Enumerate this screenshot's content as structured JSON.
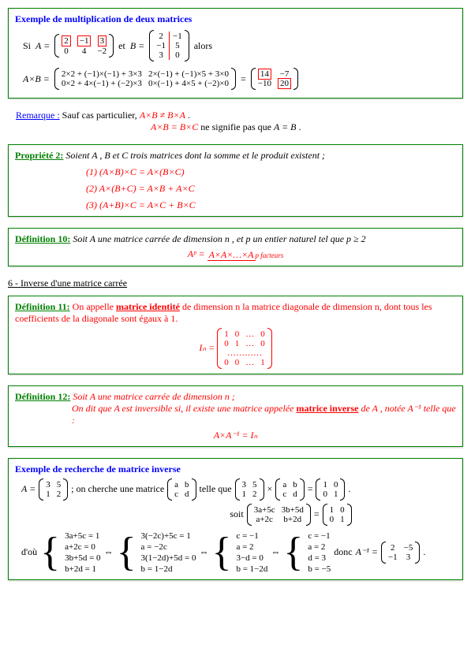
{
  "box1": {
    "title": "Exemple de multiplication de deux matrices",
    "si": "Si",
    "aeq": "A =",
    "et": "et",
    "beq": "B =",
    "A": [
      [
        "2",
        "−1",
        "3"
      ],
      [
        "0",
        "4",
        "−2"
      ]
    ],
    "B": [
      [
        "2",
        "−1"
      ],
      [
        "−1",
        "5"
      ],
      [
        "3",
        "0"
      ]
    ],
    "alors": "alors",
    "axb": "A×B =",
    "expand": [
      [
        "2×2 + (−1)×(−1) + 3×3",
        "2×(−1) + (−1)×5 + 3×0"
      ],
      [
        "0×2 + 4×(−1) + (−2)×3",
        "0×(−1) + 4×5 + (−2)×0"
      ]
    ],
    "eq": "=",
    "result": [
      [
        "14",
        "−7"
      ],
      [
        "−10",
        "20"
      ]
    ]
  },
  "remark": {
    "label": "Remarque :",
    "l1a": "Sauf cas particulier, ",
    "l1b": "A×B ≠ B×A",
    "dot1": ".",
    "l2": "A×B = B×C",
    "l2b": " ne signifie pas que ",
    "l2c": "A = B",
    "dot2": " ."
  },
  "box2": {
    "title": "Propriété 2:",
    "intro": " Soient A , B et C trois matrices dont la somme et le produit existent ;",
    "p1": "(1) (A×B)×C = A×(B×C)",
    "p2": "(2) A×(B+C) = A×B + A×C",
    "p3": "(3) (A+B)×C = A×C + B×C"
  },
  "box3": {
    "title": "Définition 10:",
    "intro": " Soit A une matrice carrée de dimension n , et p un entier naturel tel que p ≥ 2",
    "ap": "Aᵖ = ",
    "top": "A×A×…×A",
    "bot": "p facteurs"
  },
  "section6": "6 - Inverse d'une matrice carrée",
  "box4": {
    "title": "Définition 11:",
    "l1": " On appelle ",
    "u1": "matrice identité",
    "l2": " de dimension n la matrice diagonale de dimension n, dont tous les coefficients de la diagonale sont égaux à 1.",
    "in": "Iₙ =",
    "M": [
      [
        "1",
        "0",
        "…",
        "0"
      ],
      [
        "0",
        "1",
        "…",
        "0"
      ],
      [
        "",
        "…………",
        "",
        " "
      ],
      [
        "0",
        "0",
        "…",
        "1"
      ]
    ]
  },
  "box5": {
    "title": "Définition 12:",
    "l1": " Soit A une matrice carrée de dimension n ;",
    "l2a": "On dit que A est inversible si, il existe une matrice appelée ",
    "u2": "matrice inverse",
    "l2b": " de A , notée A⁻¹ telle que :",
    "eq": "A×A⁻¹ = Iₙ"
  },
  "box6": {
    "title": "Exemple de recherche de matrice inverse",
    "aeq": "A =",
    "A": [
      [
        "3",
        "5"
      ],
      [
        "1",
        "2"
      ]
    ],
    "txt1": "; on cherche une matrice",
    "ab": [
      [
        "a",
        "b"
      ],
      [
        "c",
        "d"
      ]
    ],
    "txt2": "telle que",
    "times": "×",
    "eq": "=",
    "I": [
      [
        "1",
        "0"
      ],
      [
        "0",
        "1"
      ]
    ],
    "dot": ".",
    "soit": "soit",
    "prod": [
      [
        "3a+5c",
        "3b+5d"
      ],
      [
        "a+2c",
        "b+2d"
      ]
    ],
    "dou": "d'où",
    "sys1": [
      "3a+5c = 1",
      "a+2c = 0",
      "3b+5d = 0",
      "b+2d = 1"
    ],
    "iff": "⇔",
    "sys2": [
      "3(−2c)+5c = 1",
      "a = −2c",
      "3(1−2d)+5d = 0",
      "b = 1−2d"
    ],
    "sys3": [
      "c = −1",
      "a = 2",
      "3−d = 0",
      "b = 1−2d"
    ],
    "sys4": [
      "c = −1",
      "a = 2",
      "d = 3",
      "b = −5"
    ],
    "donc": "donc",
    "ainv": "A⁻¹ =",
    "R": [
      [
        "2",
        "−5"
      ],
      [
        "−1",
        "3"
      ]
    ]
  }
}
